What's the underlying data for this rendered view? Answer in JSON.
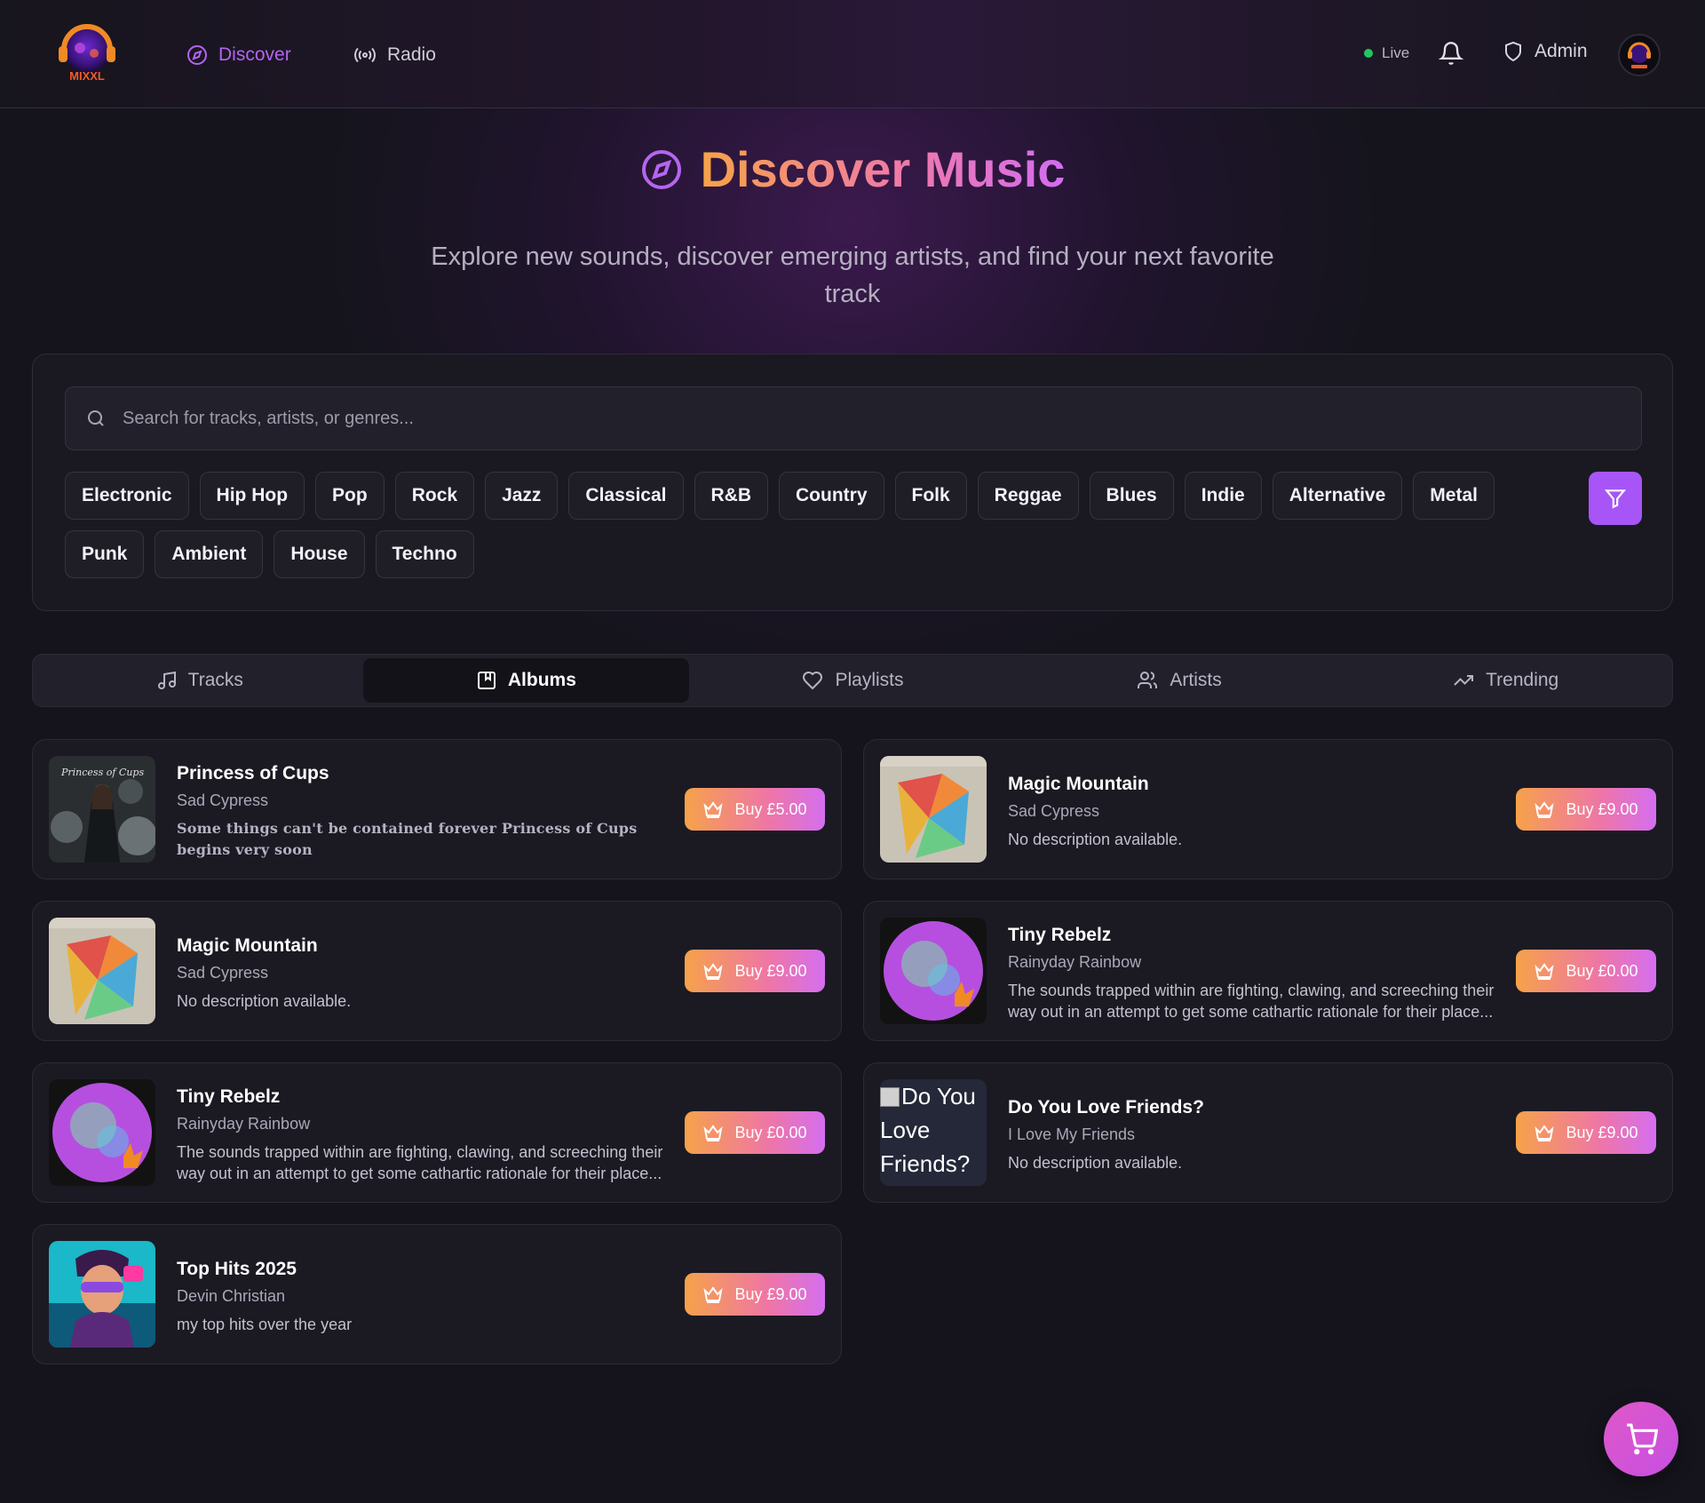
{
  "header": {
    "logo_text": "MIXXL",
    "nav": [
      {
        "label": "Discover",
        "icon": "compass-icon",
        "active": true
      },
      {
        "label": "Radio",
        "icon": "radio-icon",
        "active": false
      }
    ],
    "live_label": "Live",
    "admin_label": "Admin",
    "accent": "#a855f7"
  },
  "hero": {
    "title": "Discover Music",
    "subtitle": "Explore new sounds, discover emerging artists, and find your next favorite track"
  },
  "search": {
    "placeholder": "Search for tracks, artists, or genres..."
  },
  "genres": [
    "Electronic",
    "Hip Hop",
    "Pop",
    "Rock",
    "Jazz",
    "Classical",
    "R&B",
    "Country",
    "Folk",
    "Reggae",
    "Blues",
    "Indie",
    "Alternative",
    "Metal",
    "Punk",
    "Ambient",
    "House",
    "Techno"
  ],
  "tabs": [
    {
      "label": "Tracks",
      "icon": "music-note-icon",
      "active": false
    },
    {
      "label": "Albums",
      "icon": "album-icon",
      "active": true
    },
    {
      "label": "Playlists",
      "icon": "heart-icon",
      "active": false
    },
    {
      "label": "Artists",
      "icon": "users-icon",
      "active": false
    },
    {
      "label": "Trending",
      "icon": "trending-up-icon",
      "active": false
    }
  ],
  "albums": [
    {
      "title": "Princess of Cups",
      "artist": "Sad Cypress",
      "description": "Some things can't be contained forever Princess of Cups begins very soon",
      "price": "Buy £5.00",
      "cover_text": "Princess of Cups"
    },
    {
      "title": "Magic Mountain",
      "artist": "Sad Cypress",
      "description": "No description available.",
      "price": "Buy £9.00"
    },
    {
      "title": "Magic Mountain",
      "artist": "Sad Cypress",
      "description": "No description available.",
      "price": "Buy £9.00"
    },
    {
      "title": "Tiny Rebelz",
      "artist": "Rainyday Rainbow",
      "description": "The sounds trapped within are fighting, clawing, and screeching their way out in an attempt to get some cathartic rationale for their place...",
      "price": "Buy £0.00"
    },
    {
      "title": "Tiny Rebelz",
      "artist": "Rainyday Rainbow",
      "description": "The sounds trapped within are fighting, clawing, and screeching their way out in an attempt to get some cathartic rationale for their place...",
      "price": "Buy £0.00"
    },
    {
      "title": "Do You Love Friends?",
      "artist": "I Love My Friends",
      "description": "No description available.",
      "price": "Buy £9.00",
      "cover_alt": "Do You Love Friends?"
    },
    {
      "title": "Top Hits 2025",
      "artist": "Devin Christian",
      "description": "my top hits over the year",
      "price": "Buy £9.00"
    }
  ]
}
